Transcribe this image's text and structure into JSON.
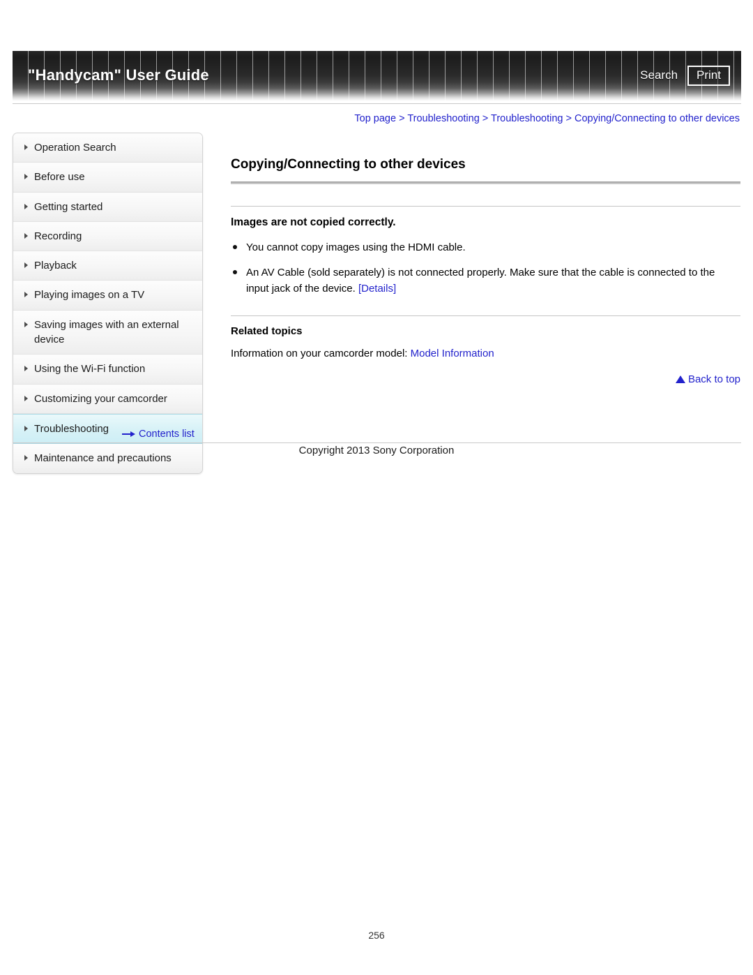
{
  "header": {
    "title": "\"Handycam\" User Guide",
    "search_label": "Search",
    "print_label": "Print"
  },
  "breadcrumb": {
    "separator": " > ",
    "items": [
      {
        "label": "Top page"
      },
      {
        "label": "Troubleshooting"
      },
      {
        "label": "Troubleshooting"
      },
      {
        "label": "Copying/Connecting to other devices"
      }
    ]
  },
  "sidebar": {
    "items": [
      {
        "label": "Operation Search",
        "selected": false
      },
      {
        "label": "Before use",
        "selected": false
      },
      {
        "label": "Getting started",
        "selected": false
      },
      {
        "label": "Recording",
        "selected": false
      },
      {
        "label": "Playback",
        "selected": false
      },
      {
        "label": "Playing images on a TV",
        "selected": false
      },
      {
        "label": "Saving images with an external device",
        "selected": false
      },
      {
        "label": "Using the Wi-Fi function",
        "selected": false
      },
      {
        "label": "Customizing your camcorder",
        "selected": false
      },
      {
        "label": "Troubleshooting",
        "selected": true
      },
      {
        "label": "Maintenance and precautions",
        "selected": false
      }
    ],
    "contents_list_label": "Contents list"
  },
  "main": {
    "title": "Copying/Connecting to other devices",
    "subheading": "Images are not copied correctly.",
    "bullets": [
      {
        "text": "You cannot copy images using the HDMI cable.",
        "link": ""
      },
      {
        "text": "An AV Cable (sold separately) is not connected properly. Make sure that the cable is connected to the input jack of the device. ",
        "link": "[Details]"
      }
    ],
    "related_heading": "Related topics",
    "related_text": "Information on your camcorder model: ",
    "related_link": "Model Information",
    "back_to_top_label": "Back to top"
  },
  "footer": {
    "copyright": "Copyright 2013 Sony Corporation",
    "page_number": "256"
  },
  "colors": {
    "link": "#2222cc",
    "selected_nav_bg": "#d8f2f7",
    "banner_dark": "#1c1c1c"
  }
}
